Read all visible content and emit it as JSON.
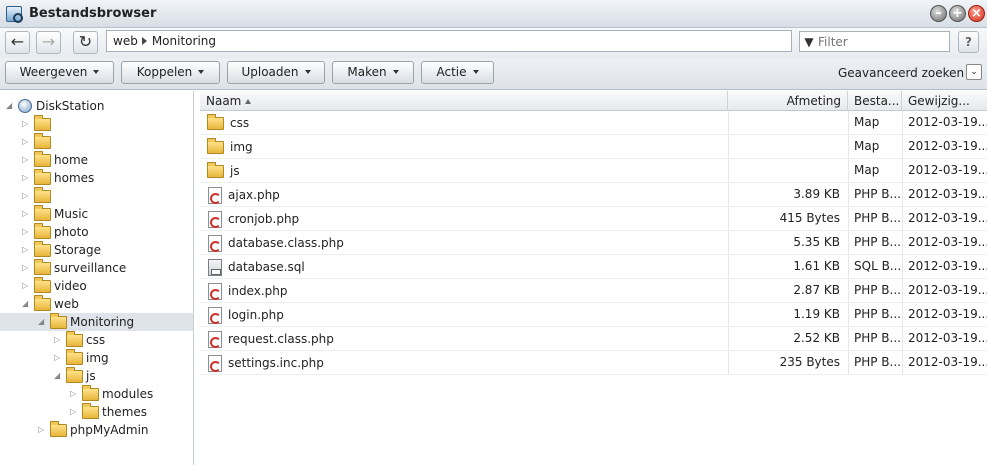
{
  "window": {
    "title": "Bestandsbrowser"
  },
  "nav": {
    "path": [
      "web",
      "Monitoring"
    ],
    "filter_placeholder": "Filter",
    "help": "?"
  },
  "toolbar": {
    "buttons": [
      "Weergeven",
      "Koppelen",
      "Uploaden",
      "Maken",
      "Actie"
    ],
    "advanced": "Geavanceerd zoeken"
  },
  "tree": {
    "root": "DiskStation",
    "items": [
      "home",
      "homes",
      "Music",
      "photo",
      "Storage",
      "surveillance",
      "video",
      "web",
      "Monitoring",
      "css",
      "img",
      "js",
      "modules",
      "themes",
      "phpMyAdmin"
    ]
  },
  "table": {
    "headers": {
      "name": "Naam",
      "size": "Afmeting",
      "type": "Besta...",
      "date": "Gewijzig..."
    },
    "rows": [
      {
        "name": "css",
        "size": "",
        "type": "Map",
        "date": "2012-03-19...",
        "icon": "folder-icon"
      },
      {
        "name": "img",
        "size": "",
        "type": "Map",
        "date": "2012-03-19...",
        "icon": "folder-icon"
      },
      {
        "name": "js",
        "size": "",
        "type": "Map",
        "date": "2012-03-19...",
        "icon": "folder-icon"
      },
      {
        "name": "ajax.php",
        "size": "3.89 KB",
        "type": "PHP B...",
        "date": "2012-03-19...",
        "icon": "php-file-icon"
      },
      {
        "name": "cronjob.php",
        "size": "415 Bytes",
        "type": "PHP B...",
        "date": "2012-03-19...",
        "icon": "php-file-icon"
      },
      {
        "name": "database.class.php",
        "size": "5.35 KB",
        "type": "PHP B...",
        "date": "2012-03-19...",
        "icon": "php-file-icon"
      },
      {
        "name": "database.sql",
        "size": "1.61 KB",
        "type": "SQL B...",
        "date": "2012-03-19...",
        "icon": "sql-file-icon"
      },
      {
        "name": "index.php",
        "size": "2.87 KB",
        "type": "PHP B...",
        "date": "2012-03-19...",
        "icon": "php-file-icon"
      },
      {
        "name": "login.php",
        "size": "1.19 KB",
        "type": "PHP B...",
        "date": "2012-03-19...",
        "icon": "php-file-icon"
      },
      {
        "name": "request.class.php",
        "size": "2.52 KB",
        "type": "PHP B...",
        "date": "2012-03-19...",
        "icon": "php-file-icon"
      },
      {
        "name": "settings.inc.php",
        "size": "235 Bytes",
        "type": "PHP B...",
        "date": "2012-03-19...",
        "icon": "php-file-icon"
      }
    ]
  }
}
